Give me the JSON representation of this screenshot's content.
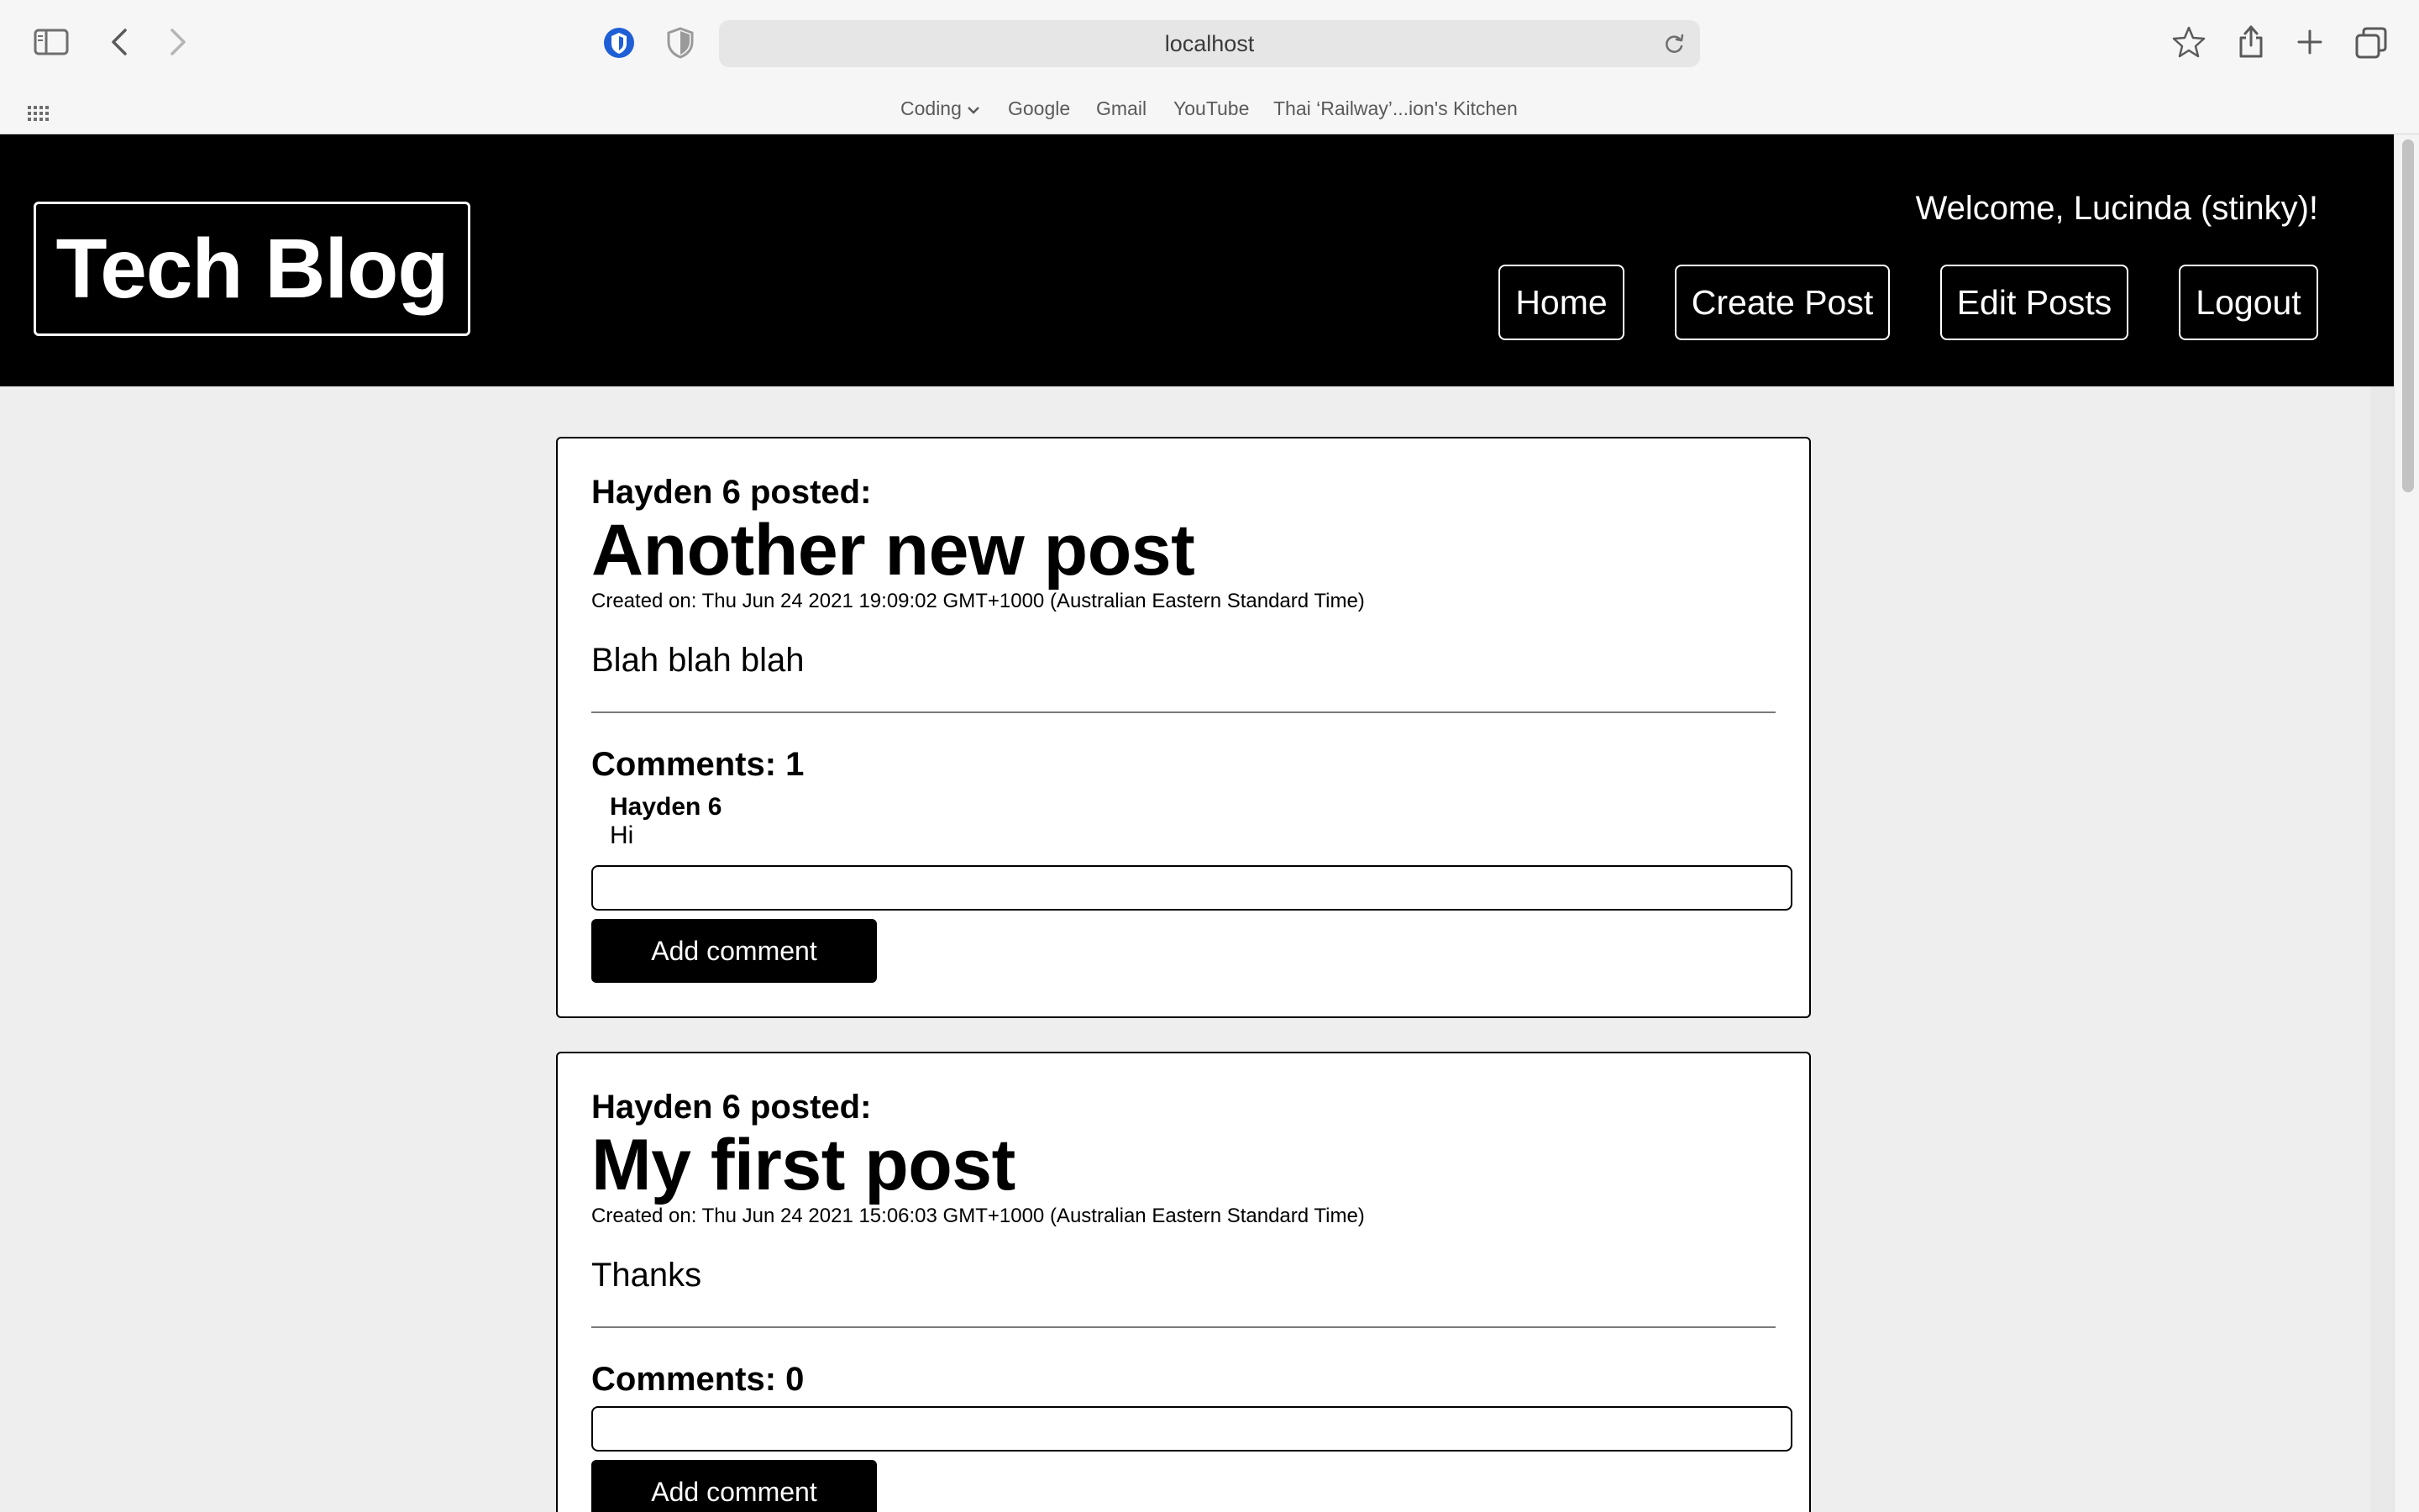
{
  "browser": {
    "url": "localhost",
    "bookmarks": [
      "Coding",
      "Google",
      "Gmail",
      "YouTube",
      "Thai ‘Railway’...ion's Kitchen"
    ]
  },
  "header": {
    "logo": "Tech Blog",
    "welcome": "Welcome, Lucinda (stinky)!",
    "nav": [
      "Home",
      "Create Post",
      "Edit Posts",
      "Logout"
    ]
  },
  "posts": [
    {
      "author_line": "Hayden 6 posted:",
      "title": "Another new post",
      "created": "Created on: Thu Jun 24 2021 19:09:02 GMT+1000 (Australian Eastern Standard Time)",
      "body": "Blah blah blah",
      "comments_label": "Comments: 1",
      "comments": [
        {
          "author": "Hayden 6",
          "text": "Hi"
        }
      ],
      "comment_input_value": "",
      "add_comment_label": "Add comment"
    },
    {
      "author_line": "Hayden 6 posted:",
      "title": "My first post",
      "created": "Created on: Thu Jun 24 2021 15:06:03 GMT+1000 (Australian Eastern Standard Time)",
      "body": "Thanks",
      "comments_label": "Comments: 0",
      "comments": [],
      "comment_input_value": "",
      "add_comment_label": "Add comment"
    }
  ]
}
